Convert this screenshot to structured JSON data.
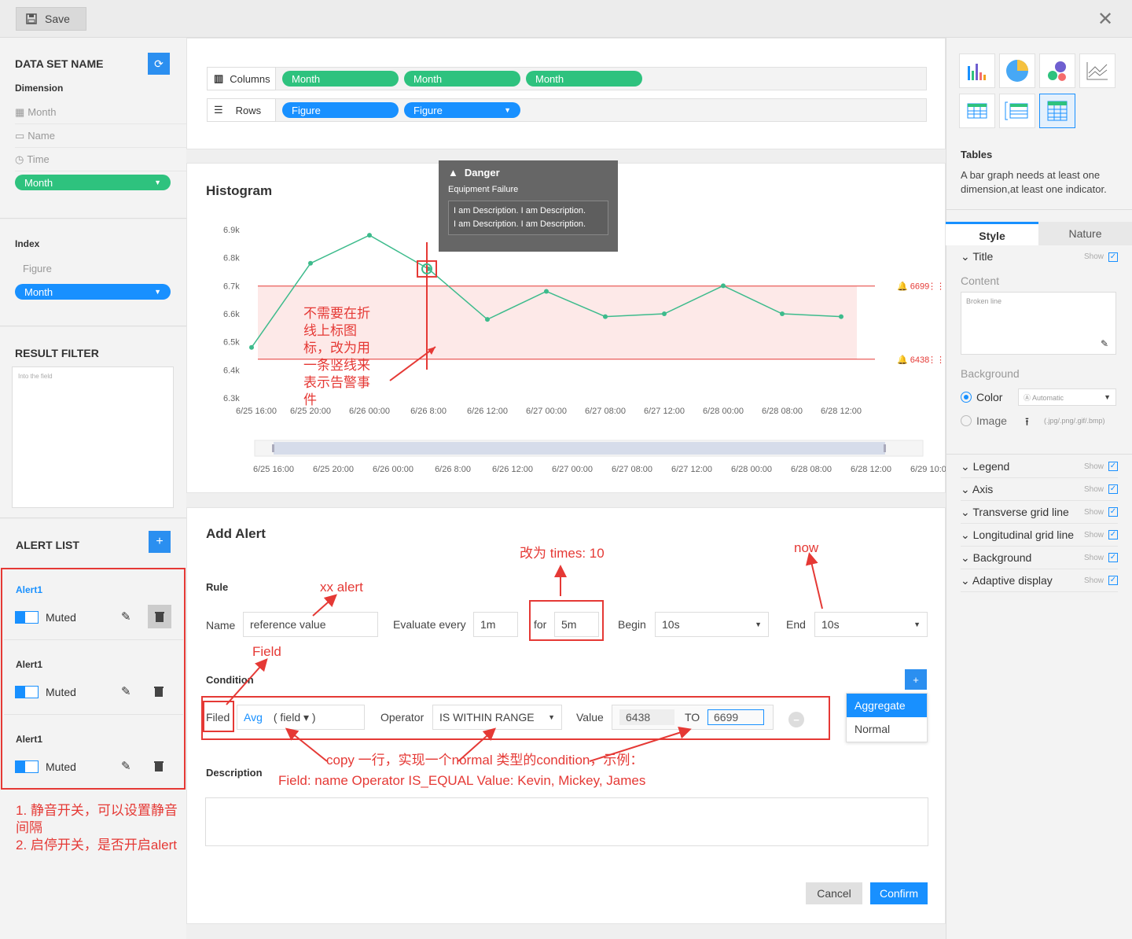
{
  "toolbar": {
    "save_label": "Save"
  },
  "left": {
    "dataset_title": "DATA SET NAME",
    "dimension_label": "Dimension",
    "dimensions": [
      "Month",
      "Name",
      "Time"
    ],
    "dimension_select": "Month",
    "index_label": "Index",
    "index_item": "Figure",
    "index_select": "Month",
    "result_filter_label": "RESULT FILTER",
    "filter_placeholder": "Into the field",
    "alert_list_label": "ALERT LIST",
    "alerts": [
      {
        "name": "Alert1",
        "toggle_label": "Muted"
      },
      {
        "name": "Alert1",
        "toggle_label": "Muted"
      },
      {
        "name": "Alert1",
        "toggle_label": "Muted"
      }
    ],
    "note": "1. 静音开关，可以设置静音间隔\n2. 启停开关，是否开启alert"
  },
  "fields": {
    "columns_label": "Columns",
    "columns": [
      "Month",
      "Month",
      "Month"
    ],
    "rows_label": "Rows",
    "rows": [
      "Figure",
      "Figure"
    ]
  },
  "chart": {
    "title": "Histogram",
    "tooltip": {
      "title": "Danger",
      "subtitle": "Equipment Failure",
      "desc1": "I am Description. I am Description.",
      "desc2": "I am Description. I am Description."
    },
    "upper_label": "6699",
    "lower_label": "6438",
    "annotation": "不需要在折线上标图标，改为用一条竖线来表示告警事件",
    "slider_ticks": [
      "6/25 16:00",
      "6/25 20:00",
      "6/26 00:00",
      "6/26  8:00",
      "6/26 12:00",
      "6/27 00:00",
      "6/27 08:00",
      "6/27 12:00",
      "6/28 00:00",
      "6/28 08:00",
      "6/28 12:00",
      "6/29 10:00"
    ]
  },
  "chart_data": {
    "type": "line",
    "categories": [
      "6/25 16:00",
      "6/25 20:00",
      "6/26 00:00",
      "6/26  8:00",
      "6/26 12:00",
      "6/27 00:00",
      "6/27 08:00",
      "6/27 12:00",
      "6/28 00:00",
      "6/28 08:00",
      "6/28 12:00"
    ],
    "x_positions_index": [
      0,
      1,
      2,
      3,
      4,
      5,
      6,
      7,
      8,
      9,
      10
    ],
    "values": [
      6.48,
      6.78,
      6.88,
      6.76,
      6.58,
      6.68,
      6.59,
      6.6,
      6.7,
      6.6,
      6.59
    ],
    "yticks": [
      "6.9k",
      "6.8k",
      "6.7k",
      "6.6k",
      "6.5k",
      "6.4k",
      "6.3k"
    ],
    "ylim": [
      6.3,
      6.9
    ],
    "thresholds": {
      "upper": 6699,
      "lower": 6438
    },
    "line_color": "#3dbb8c",
    "band_color": "#fde9e8",
    "alert_index": 3
  },
  "alert": {
    "title": "Add Alert",
    "rule_label": "Rule",
    "name_label": "Name",
    "name_value": "reference value",
    "evaluate_label": "Evaluate every",
    "evaluate_value": "1m",
    "for_label": "for",
    "for_value": "5m",
    "begin_label": "Begin",
    "begin_value": "10s",
    "end_label": "End",
    "end_value": "10s",
    "condition_label": "Condition",
    "filed_label": "Filed",
    "avg_value": "Avg",
    "field_value": "( field  ▾ )",
    "operator_label": "Operator",
    "operator_value": "IS WITHIN RANGE",
    "value_label": "Value",
    "value_from": "6438",
    "to_label": "TO",
    "value_to": "6699",
    "dropdown_options": [
      "Aggregate",
      "Normal"
    ],
    "description_label": "Description",
    "cancel_label": "Cancel",
    "confirm_label": "Confirm",
    "notes": {
      "xx_alert": "xx alert",
      "times": "改为 times: 10",
      "now": "now",
      "field": "Field",
      "copy1": "copy 一行，实现一个normal 类型的condition，示例：",
      "copy2": "Field: name  Operator IS_EQUAL Value: Kevin, Mickey, James"
    }
  },
  "right": {
    "chart_type_title": "Tables",
    "chart_type_desc": "A bar graph needs at least one dimension,at least one indicator.",
    "tab_style": "Style",
    "tab_nature": "Nature",
    "title_row": "Title",
    "show_label": "Show",
    "content_label": "Content",
    "content_placeholder": "Broken line",
    "background_label": "Background",
    "color_label": "Color",
    "color_select": "Automatic",
    "image_label": "Image",
    "image_hint": "(.jpg/.png/.gif/.bmp)",
    "settings": [
      "Legend",
      "Axis",
      "Transverse grid line",
      "Longitudinal grid line",
      "Background",
      "Adaptive display"
    ]
  }
}
